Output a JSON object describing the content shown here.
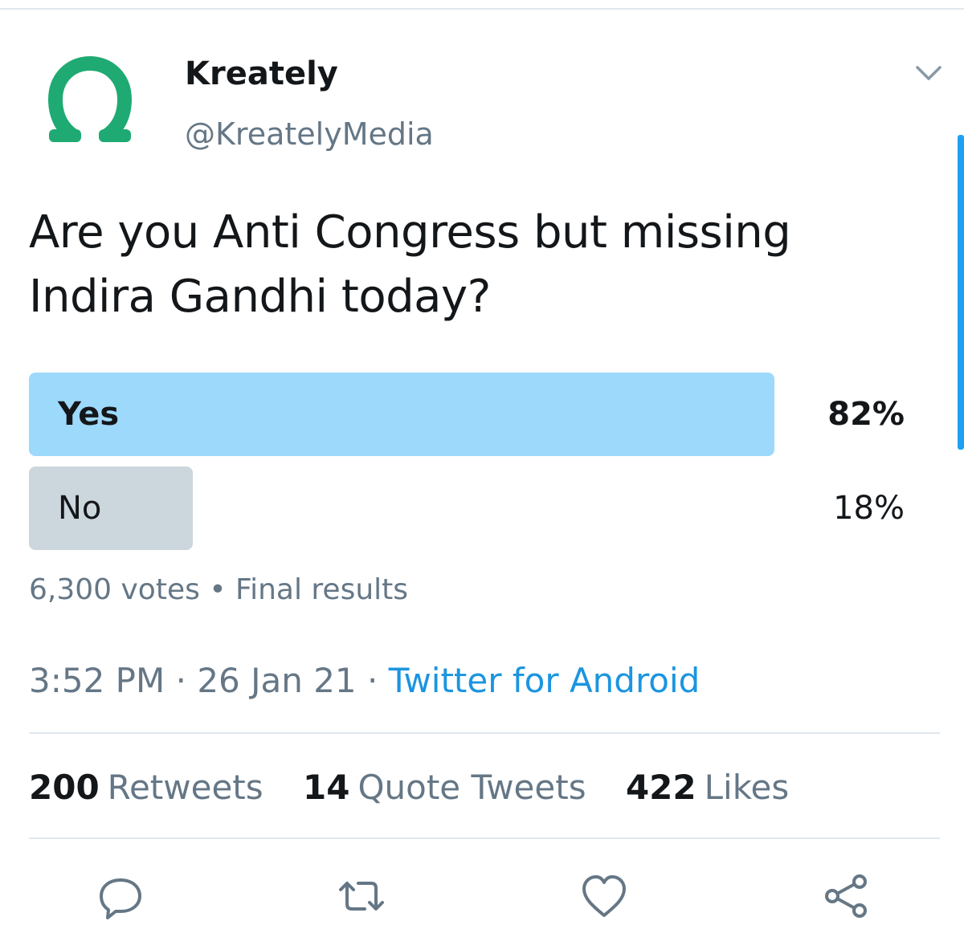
{
  "tweet": {
    "author": {
      "display_name": "Kreately",
      "handle": "@KreatelyMedia",
      "avatar_icon": "omega-logo-icon",
      "avatar_color": "#1faa73"
    },
    "text": "Are you Anti Congress but missing Indira Gandhi today?",
    "poll": {
      "options": [
        {
          "label": "Yes",
          "percent_text": "82%",
          "percent": 82,
          "winner": true,
          "bar_color": "#9dd9fb"
        },
        {
          "label": "No",
          "percent_text": "18%",
          "percent": 18,
          "winner": false,
          "bar_color": "#ccd6dd"
        }
      ],
      "votes": "6,300 votes",
      "separator": "•",
      "status": "Final results"
    },
    "time": "3:52 PM",
    "date": "26 Jan 21",
    "source": "Twitter for Android",
    "dot": "·",
    "stats": {
      "retweets": {
        "count": "200",
        "label": "Retweets"
      },
      "quotes": {
        "count": "14",
        "label": "Quote Tweets"
      },
      "likes": {
        "count": "422",
        "label": "Likes"
      }
    },
    "actions": [
      "reply-icon",
      "retweet-icon",
      "like-icon",
      "share-icon"
    ]
  },
  "colors": {
    "accent": "#1da1f2",
    "link": "#1b95e0",
    "secondary_text": "#657786",
    "primary_text": "#14171a"
  }
}
